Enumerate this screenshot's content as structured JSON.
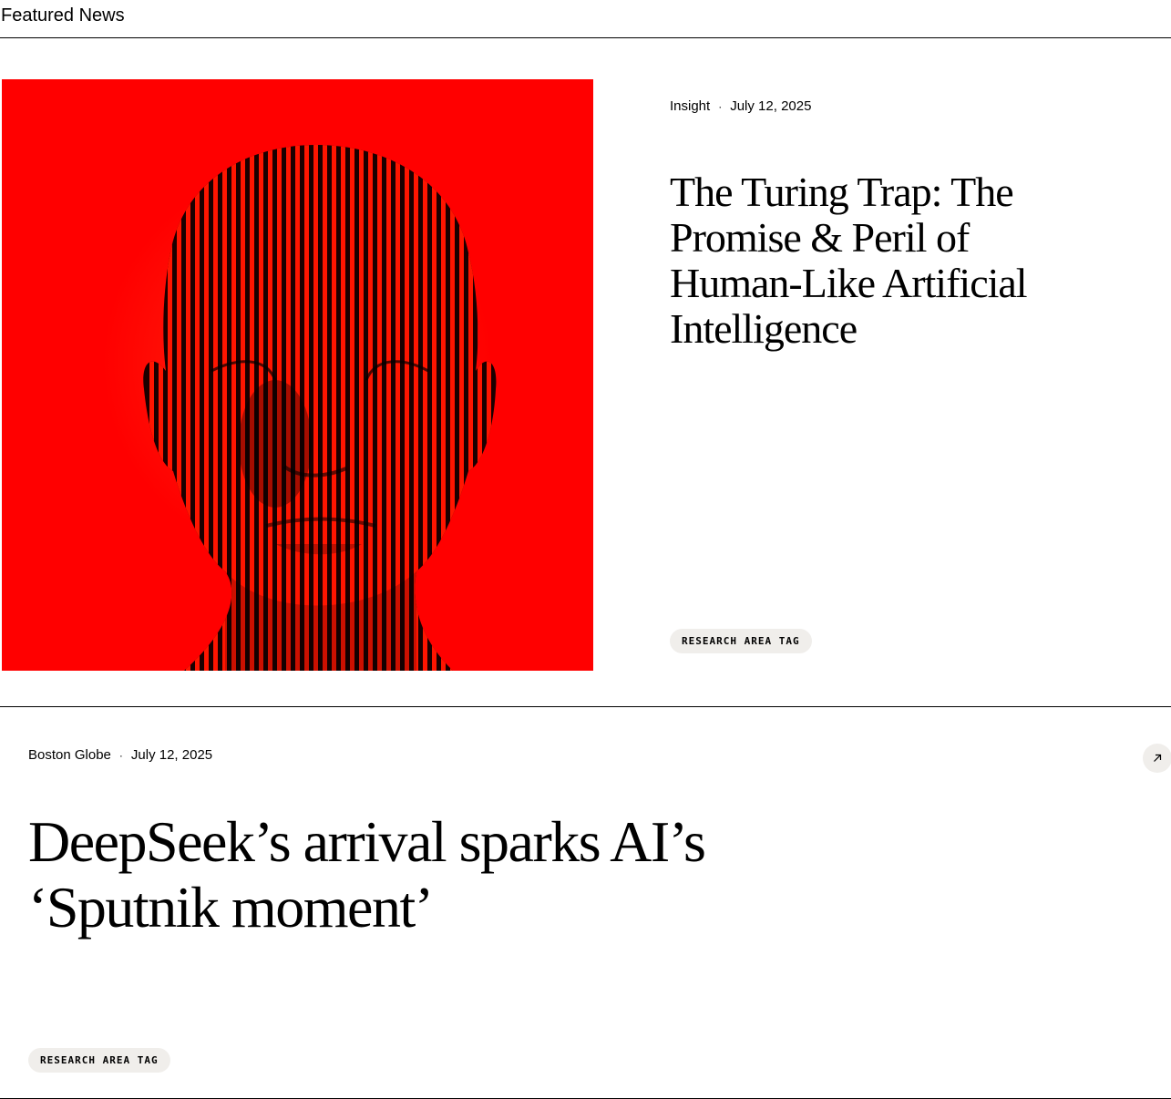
{
  "section": {
    "title": "Featured News"
  },
  "featured": {
    "source": "Insight",
    "separator": "·",
    "date": "July 12, 2025",
    "title": "The Turing Trap: The Promise & Peril of Human-Like Artificial Intelligence",
    "tag": "RESEARCH AREA TAG",
    "image_background_color": "#ff0000"
  },
  "article": {
    "source": "Boston Globe",
    "separator": "·",
    "date": "July 12, 2025",
    "title": "DeepSeek’s arrival sparks AI’s ‘Sputnik moment’",
    "tag": "RESEARCH AREA TAG",
    "link_icon": "arrow-up-right-icon"
  },
  "colors": {
    "accent": "#ff0000",
    "tag_background": "#f0eeeb",
    "text": "#000000"
  }
}
